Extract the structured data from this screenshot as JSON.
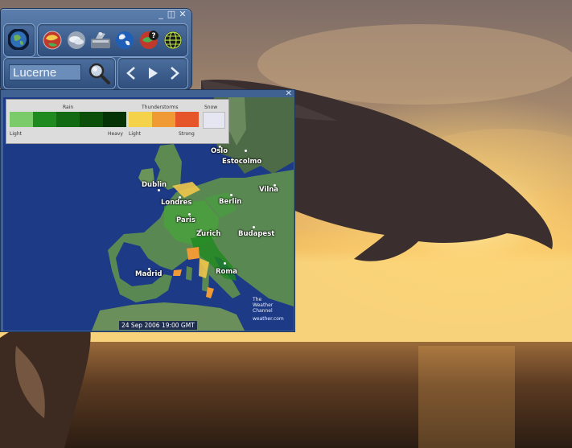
{
  "window_controls": {
    "minimize": "_",
    "maximize": "◫",
    "close": "✕"
  },
  "search": {
    "value": "Lucerne",
    "placeholder": ""
  },
  "nav": {
    "back": "<",
    "play": "▶",
    "forward": ">"
  },
  "map_window": {
    "close": "✕"
  },
  "legend": {
    "rain": {
      "title": "Rain",
      "light": "Light",
      "heavy": "Heavy",
      "colors": [
        "#7ccb6b",
        "#1f8a1f",
        "#126b12",
        "#0b4f0b",
        "#063306"
      ]
    },
    "thunderstorms": {
      "title": "Thunderstorms",
      "light": "Light",
      "strong": "Strong",
      "colors": [
        "#f4d24a",
        "#ef9a35",
        "#e6552a"
      ]
    },
    "snow": {
      "title": "Snow",
      "colors": [
        "#e6e6f2"
      ]
    }
  },
  "cities": [
    "Oslo",
    "Estocolmo",
    "Dublin",
    "Vilna",
    "Londres",
    "Berlin",
    "Paris",
    "Zurich",
    "Budapest",
    "Madrid",
    "Roma"
  ],
  "timestamp": "24 Sep 2006 19:00 GMT",
  "brand": {
    "line1": "The",
    "line2": "Weather",
    "line3": "Channel",
    "url": "weather.com"
  },
  "icons": [
    "globe-logo-icon",
    "weather-globe-icon",
    "cloud-globe-icon",
    "radar-dish-icon",
    "blue-globe-icon",
    "help-globe-icon",
    "wireframe-globe-icon",
    "search-icon"
  ],
  "colors": {
    "accent": "#3f6292",
    "ocean": "#1d3a86",
    "land": "#5f8f56"
  }
}
